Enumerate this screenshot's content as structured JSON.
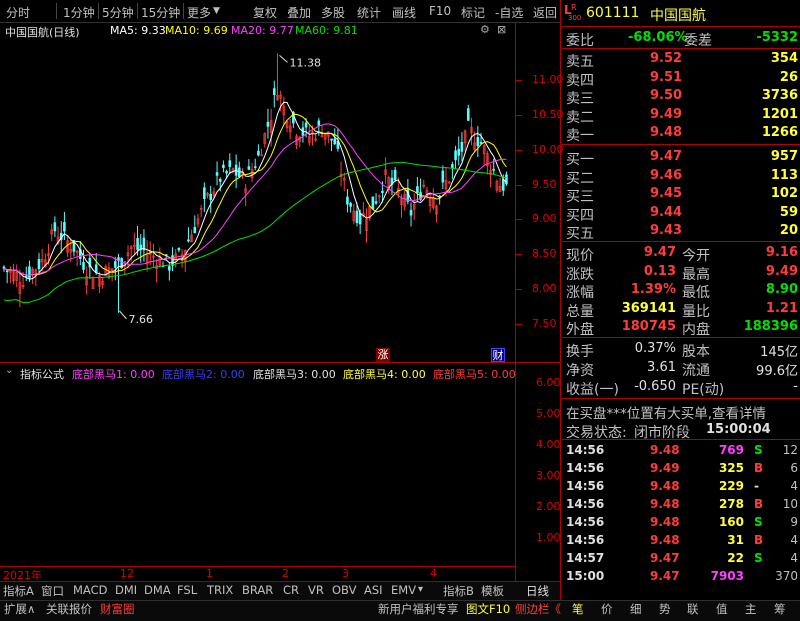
{
  "toolbar": {
    "left": [
      "分时",
      "1分钟",
      "5分钟",
      "15分钟",
      "更多"
    ],
    "right": [
      "复权",
      "叠加",
      "多股",
      "统计",
      "画线",
      "F10",
      "标记",
      "-自选",
      "返回"
    ]
  },
  "stock": {
    "code": "601111",
    "name": "中国国航",
    "badge_letter": "L",
    "badge_sub": "300",
    "title": "中国国航(日线)"
  },
  "ma": {
    "ma5": "MA5: 9.33",
    "ma10": "MA10: 9.69",
    "ma20": "MA20: 9.77",
    "ma60": "MA60: 9.81",
    "colors": {
      "ma5": "#ffffff",
      "ma10": "#ffff00",
      "ma20": "#ff40ff",
      "ma60": "#00e000"
    }
  },
  "chart_data": {
    "type": "candlestick",
    "price_axis": [
      "11.00",
      "10.50",
      "10.00",
      "9.50",
      "9.00",
      "8.50",
      "8.00",
      "7.50"
    ],
    "ylim": [
      7.3,
      11.6
    ],
    "high_label": "11.38",
    "low_label": "7.66",
    "x_labels": [
      "2021年",
      "12",
      "1",
      "2",
      "3",
      "4"
    ],
    "markers": [
      "涨",
      "财"
    ],
    "indicator_axis": [
      "6.00",
      "5.00",
      "4.00",
      "3.00",
      "2.00",
      "1.00"
    ]
  },
  "indicator": {
    "title": "指标公式",
    "items": [
      {
        "label": "底部黑马1: 0.00",
        "color": "#ff40ff"
      },
      {
        "label": "底部黑马2: 0.00",
        "color": "#3c3cff"
      },
      {
        "label": "底部黑马3: 0.00",
        "color": "#e0e0e0"
      },
      {
        "label": "底部黑马4: 0.00",
        "color": "#ffff3c"
      },
      {
        "label": "底部黑马5: 0.00",
        "color": "#ff3c3c"
      }
    ]
  },
  "order_book": {
    "weibi_label": "委比",
    "weibi_value": "-68.06%",
    "weicha_label": "委差",
    "weicha_value": "-5332",
    "asks": [
      {
        "label": "卖五",
        "price": "9.52",
        "vol": "354"
      },
      {
        "label": "卖四",
        "price": "9.51",
        "vol": "26"
      },
      {
        "label": "卖三",
        "price": "9.50",
        "vol": "3736"
      },
      {
        "label": "卖二",
        "price": "9.49",
        "vol": "1201"
      },
      {
        "label": "卖一",
        "price": "9.48",
        "vol": "1266"
      }
    ],
    "bids": [
      {
        "label": "买一",
        "price": "9.47",
        "vol": "957"
      },
      {
        "label": "买二",
        "price": "9.46",
        "vol": "113"
      },
      {
        "label": "买三",
        "price": "9.45",
        "vol": "102"
      },
      {
        "label": "买四",
        "price": "9.44",
        "vol": "59"
      },
      {
        "label": "买五",
        "price": "9.43",
        "vol": "20"
      }
    ]
  },
  "quote": {
    "rows": [
      {
        "l1": "现价",
        "v1": "9.47",
        "c1": "red",
        "l2": "今开",
        "v2": "9.16",
        "c2": "red"
      },
      {
        "l1": "涨跌",
        "v1": "0.13",
        "c1": "red",
        "l2": "最高",
        "v2": "9.49",
        "c2": "red"
      },
      {
        "l1": "涨幅",
        "v1": "1.39%",
        "c1": "red",
        "l2": "最低",
        "v2": "8.90",
        "c2": "green"
      },
      {
        "l1": "总量",
        "v1": "369141",
        "c1": "yellow",
        "l2": "量比",
        "v2": "1.21",
        "c2": "red"
      },
      {
        "l1": "外盘",
        "v1": "180745",
        "c1": "red",
        "l2": "内盘",
        "v2": "188396",
        "c2": "green"
      }
    ],
    "rows2": [
      {
        "l1": "换手",
        "v1": "0.37%",
        "l2": "股本",
        "v2": "145亿"
      },
      {
        "l1": "净资",
        "v1": "3.61",
        "l2": "流通",
        "v2": "99.6亿"
      },
      {
        "l1": "收益(一)",
        "v1": "-0.650",
        "l2": "PE(动)",
        "v2": "-"
      }
    ]
  },
  "notice": "在买盘***位置有大买单,查看详情",
  "status": {
    "label": "交易状态:",
    "value": "闭市阶段",
    "time": "15:00:04"
  },
  "ticks": [
    {
      "t": "14:56",
      "p": "9.48",
      "v": "769",
      "vc": "mag",
      "s": "S",
      "sc": "green",
      "n": "12"
    },
    {
      "t": "14:56",
      "p": "9.49",
      "v": "325",
      "vc": "yellow",
      "s": "B",
      "sc": "red",
      "n": "6"
    },
    {
      "t": "14:56",
      "p": "9.48",
      "v": "229",
      "vc": "yellow",
      "s": "-",
      "sc": "white",
      "n": "4"
    },
    {
      "t": "14:56",
      "p": "9.48",
      "v": "278",
      "vc": "yellow",
      "s": "B",
      "sc": "red",
      "n": "10"
    },
    {
      "t": "14:56",
      "p": "9.48",
      "v": "160",
      "vc": "yellow",
      "s": "S",
      "sc": "green",
      "n": "9"
    },
    {
      "t": "14:56",
      "p": "9.48",
      "v": "31",
      "vc": "yellow",
      "s": "B",
      "sc": "red",
      "n": "4"
    },
    {
      "t": "14:57",
      "p": "9.47",
      "v": "22",
      "vc": "yellow",
      "s": "S",
      "sc": "green",
      "n": "4"
    },
    {
      "t": "15:00",
      "p": "9.47",
      "v": "7903",
      "vc": "mag",
      "s": "",
      "sc": "white",
      "n": "370"
    }
  ],
  "bottom_tabs": [
    "指标A",
    "窗口",
    "MACD",
    "DMI",
    "DMA",
    "FSL",
    "TRIX",
    "BRAR",
    "CR",
    "VR",
    "OBV",
    "ASI",
    "EMV",
    "指标B",
    "模板"
  ],
  "period_label": "日线",
  "bottom_left": [
    "扩展∧",
    "关联报价",
    "财富圈"
  ],
  "bottom_mid": [
    "新用户福利专享",
    "图文F10",
    "侧边栏《"
  ],
  "bottom_right": [
    "笔",
    "价",
    "细",
    "势",
    "联",
    "值",
    "主",
    "筹"
  ]
}
